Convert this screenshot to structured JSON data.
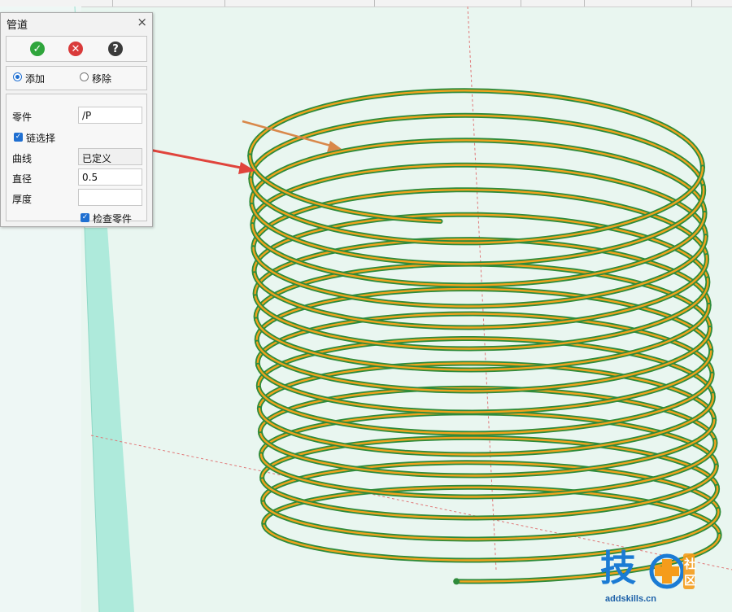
{
  "dialog": {
    "title": "管道",
    "close_symbol": "×",
    "actions": {
      "ok": {
        "icon": "check-circle-icon",
        "symbol": "✓",
        "color": "#2fa53c"
      },
      "cancel": {
        "icon": "x-circle-icon",
        "symbol": "✕",
        "color": "#d93a3a"
      },
      "help": {
        "icon": "question-circle-icon",
        "symbol": "?",
        "color": "#3a3a3a"
      }
    },
    "mode": {
      "add_label": "添加",
      "remove_label": "移除",
      "selected": "添加"
    },
    "props": {
      "part_label": "零件",
      "part_value": "/P",
      "chain_select_label": "链选择",
      "chain_select_checked": true,
      "curve_label": "曲线",
      "curve_value": "已定义",
      "diameter_label": "直径",
      "diameter_value": "0.5",
      "thickness_label": "厚度",
      "thickness_value": "",
      "check_part_label": "检查零件",
      "check_part_checked": true
    }
  },
  "scene": {
    "helix_tube_color": "#2e8b3a",
    "helix_highlight_color": "#f0a21e",
    "arrow_color": "#e0443c",
    "guide_color": "#d9884a",
    "axis_color": "#e07878",
    "background": "#e9f6f0"
  },
  "watermark": {
    "char_main": "技",
    "char_she": "社",
    "char_qu": "区",
    "url": "addskills.cn",
    "blue": "#1b7bd4",
    "orange": "#f59c1b"
  }
}
